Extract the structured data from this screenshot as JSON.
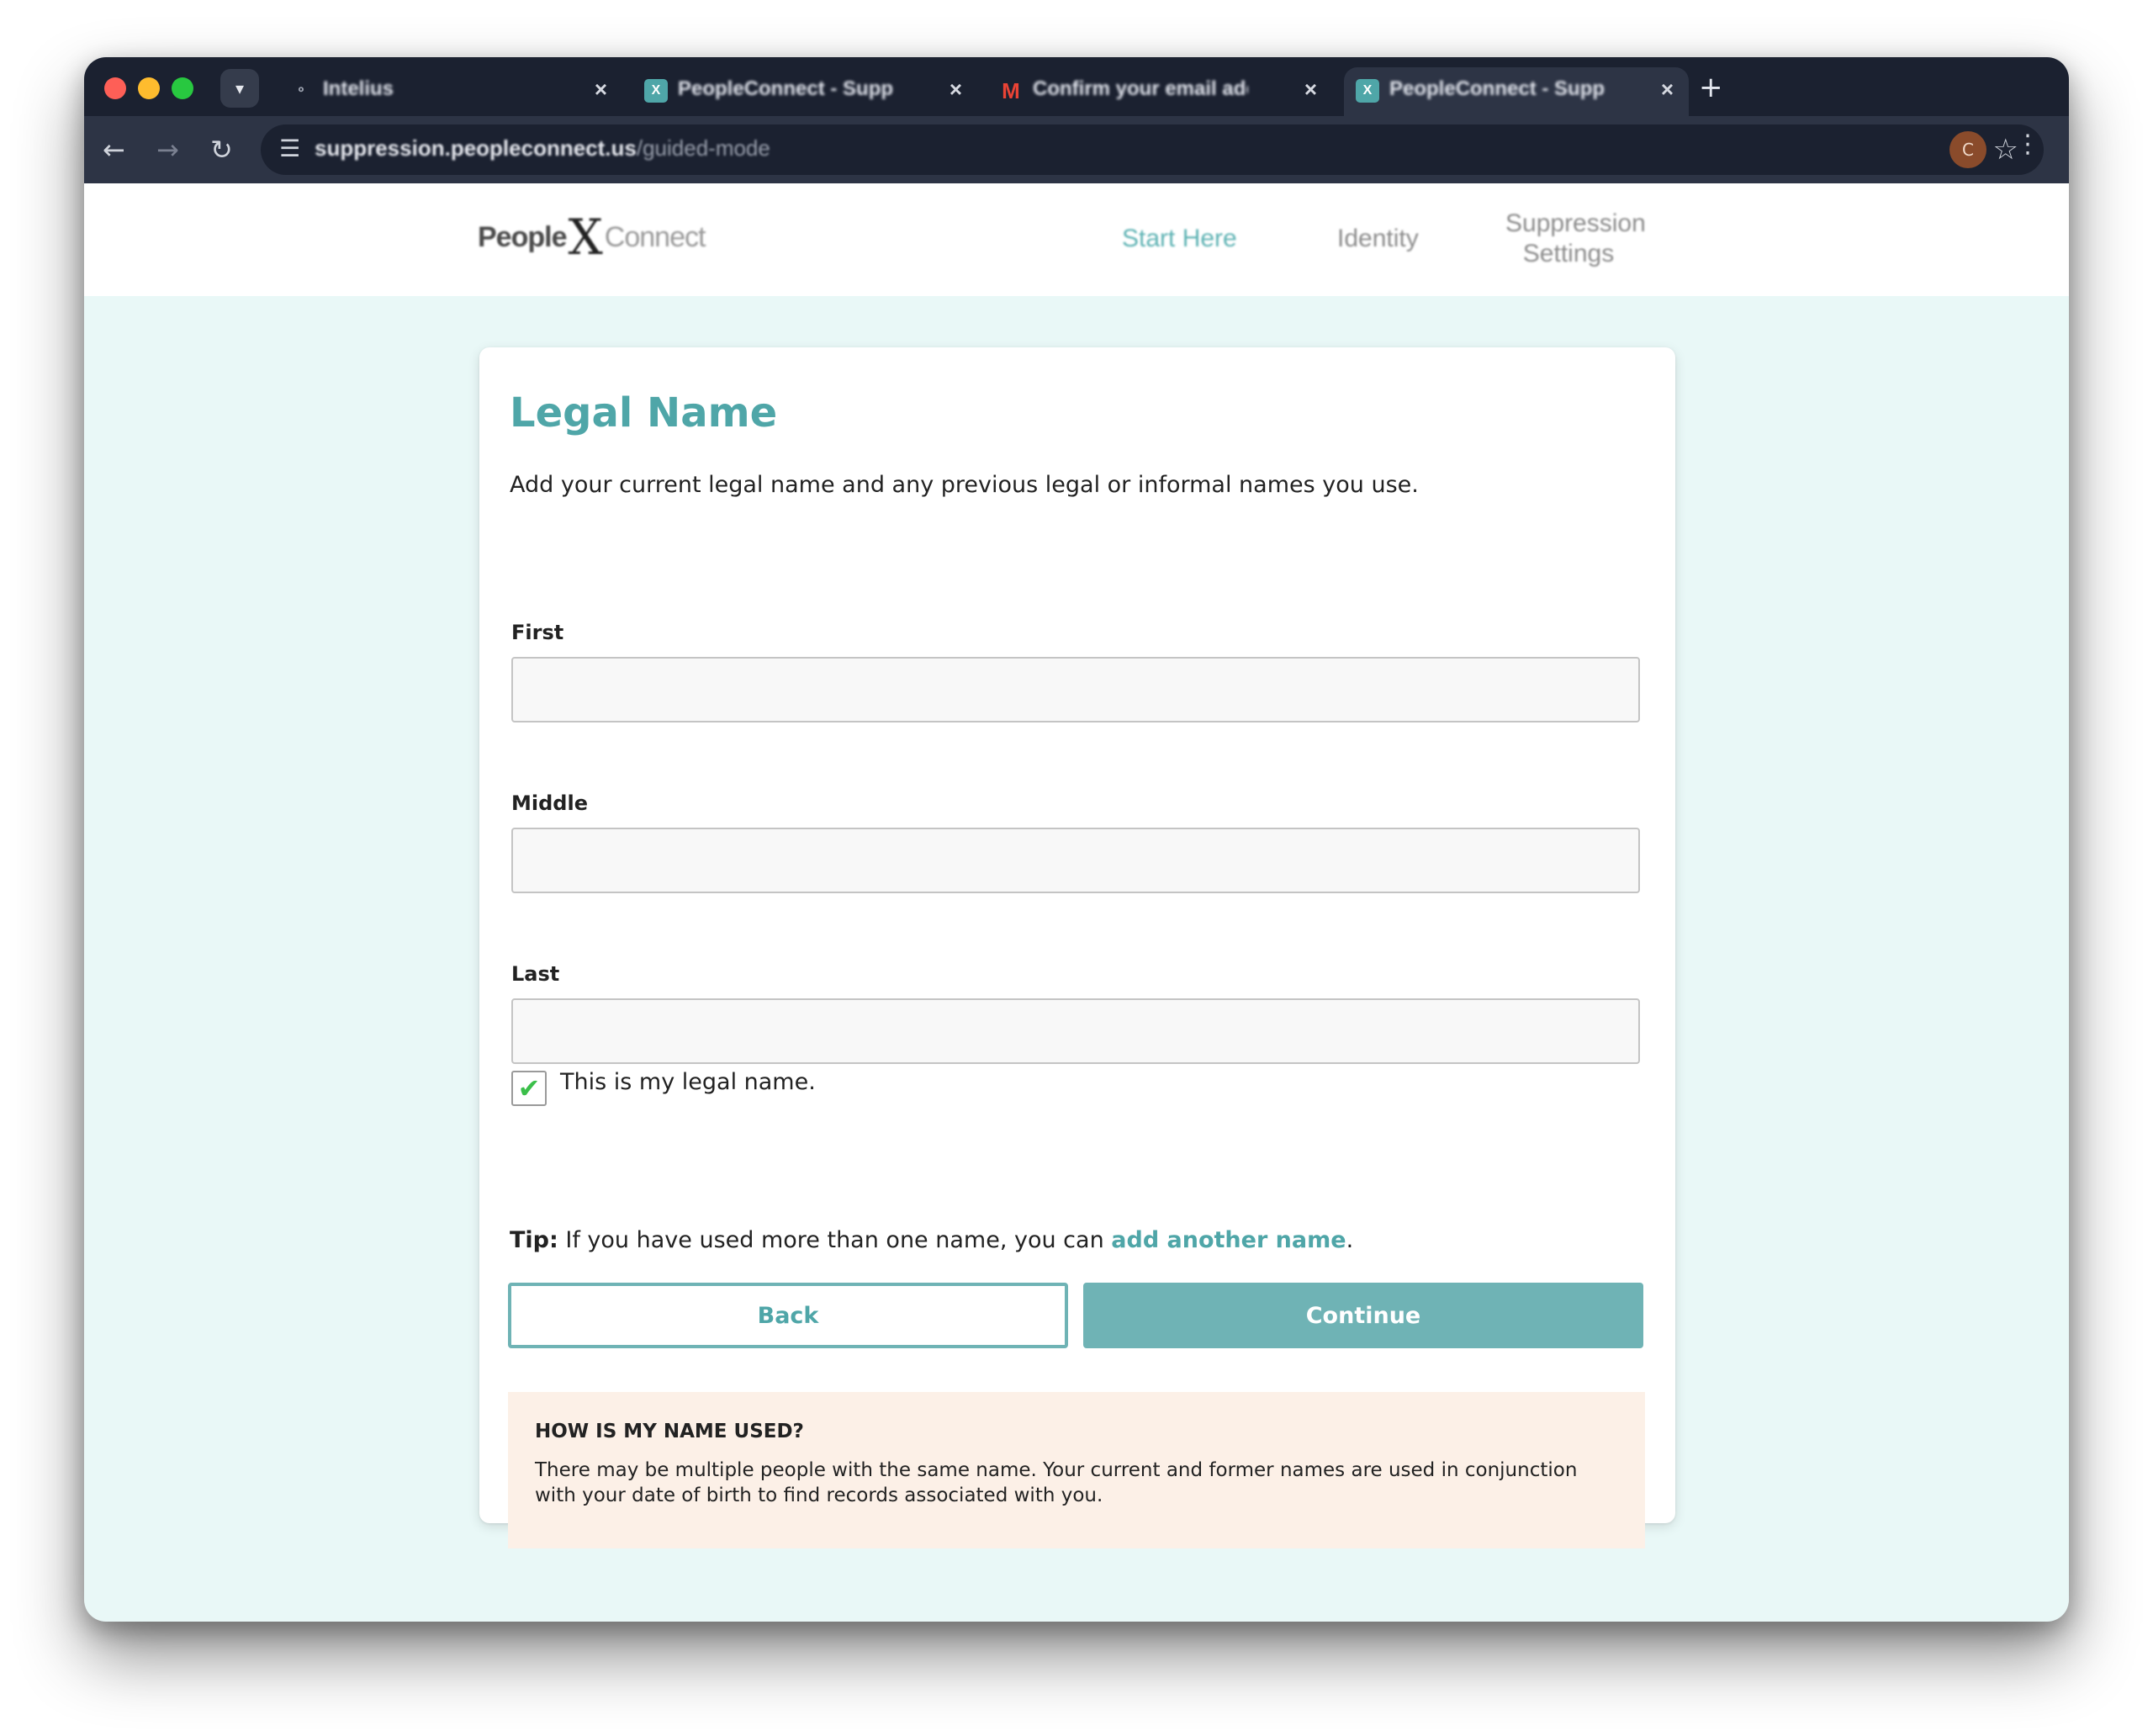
{
  "browser": {
    "tabs": [
      {
        "title": "Intelius",
        "favicon": "share-icon"
      },
      {
        "title": "PeopleConnect - Suppression",
        "favicon": "peopleconnect-icon"
      },
      {
        "title": "Confirm your email address",
        "favicon": "gmail-icon"
      },
      {
        "title": "PeopleConnect - Suppression",
        "favicon": "peopleconnect-icon",
        "active": true
      }
    ],
    "url_domain": "suppression.peopleconnect.us",
    "url_path": "/guided-mode",
    "profile_initial": "C"
  },
  "header": {
    "logo_people": "People",
    "logo_x": "X",
    "logo_connect": "Connect",
    "nav": {
      "start_here": "Start Here",
      "identity": "Identity",
      "suppression_settings": "Suppression Settings"
    }
  },
  "form": {
    "title": "Legal Name",
    "subtitle": "Add your current legal name and any previous legal or informal names you use.",
    "first_label": "First",
    "first_value": "",
    "middle_label": "Middle",
    "middle_value": "",
    "last_label": "Last",
    "last_value": "",
    "legal_checkbox_label": "This is my legal name.",
    "legal_checked": true,
    "tip_prefix": "Tip:",
    "tip_text": " If you have used more than one name, you can ",
    "tip_link": "add another name",
    "tip_suffix": ".",
    "back_label": "Back",
    "continue_label": "Continue"
  },
  "info": {
    "title": "HOW IS MY NAME USED?",
    "body": "There may be multiple people with the same name. Your current and former names are used in conjunction with your date of birth to find records associated with you."
  },
  "colors": {
    "accent": "#4fa6a8",
    "button": "#6fb3b5",
    "page_bg": "#e9f8f7",
    "info_bg": "#fcf0e7",
    "check": "#3bbf4a"
  }
}
